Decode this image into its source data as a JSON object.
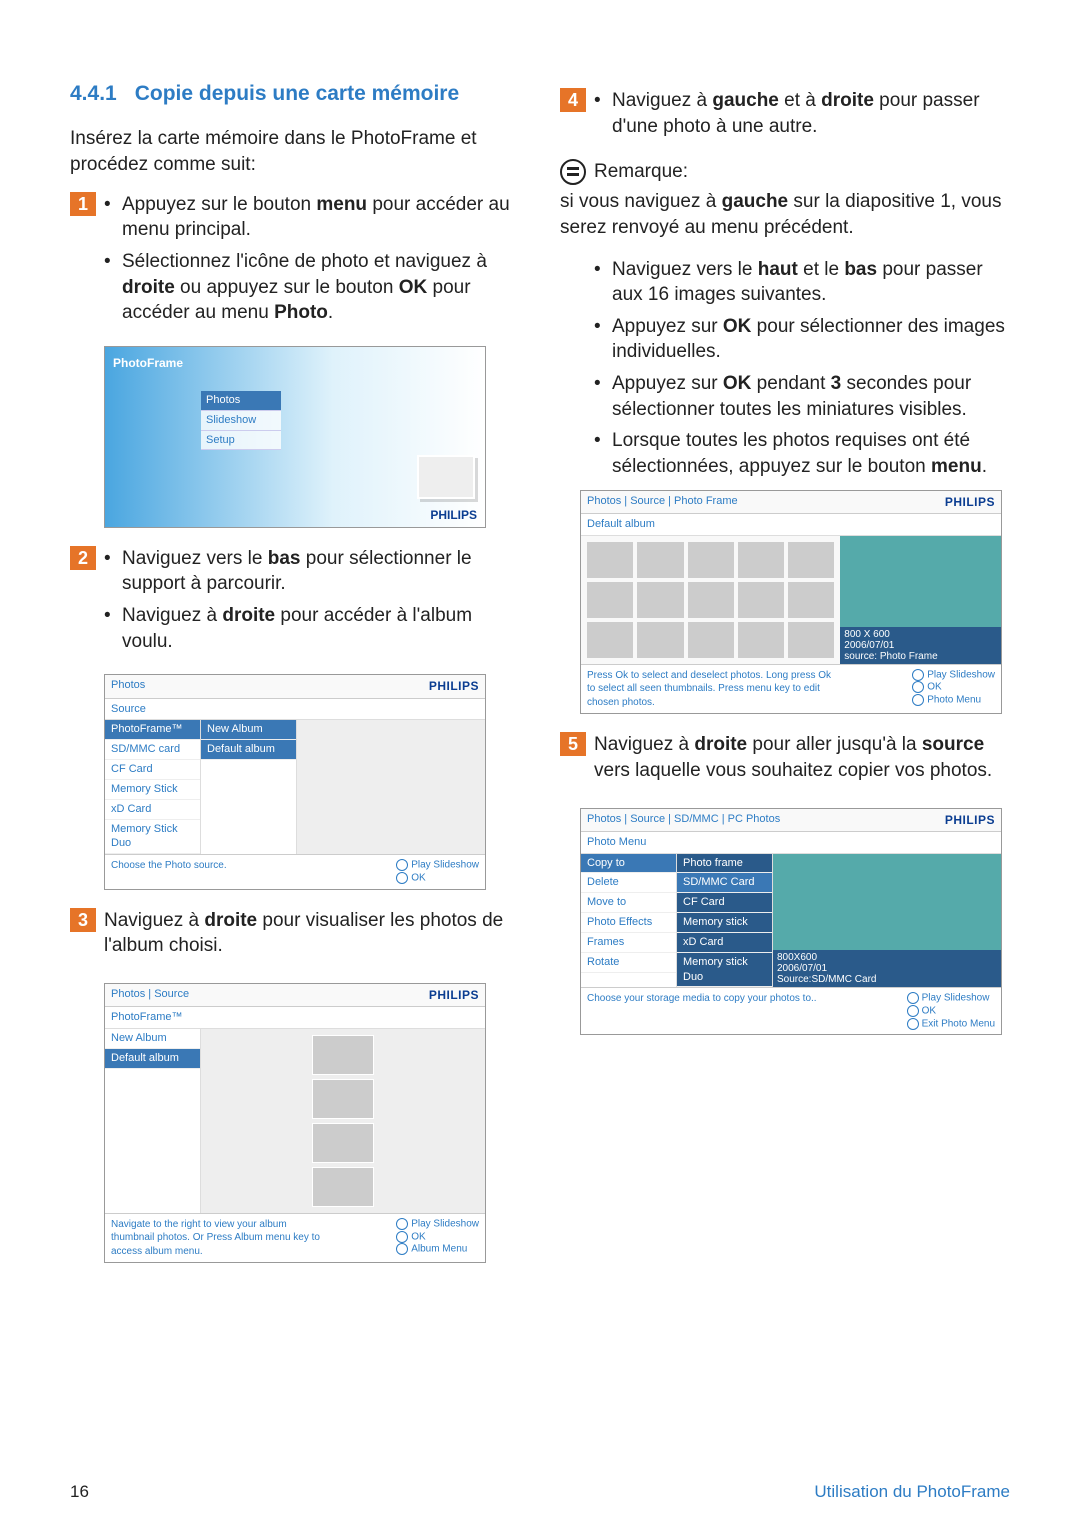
{
  "section": {
    "number": "4.4.1",
    "title": "Copie depuis une carte mémoire"
  },
  "intro": "Insérez la carte mémoire dans le PhotoFrame et procédez comme suit:",
  "step1": {
    "b1a": "Appuyez sur le bouton ",
    "b1b": "menu",
    "b1c": " pour accéder au menu principal.",
    "b2a": "Sélectionnez l'icône de photo et naviguez à ",
    "b2b": "droite",
    "b2c": " ou appuyez sur le bouton ",
    "b2d": "OK",
    "b2e": " pour accéder au menu ",
    "b2f": "Photo",
    "b2g": "."
  },
  "ss_main": {
    "title": "PhotoFrame",
    "items": [
      "Photos",
      "Slideshow",
      "Setup"
    ],
    "brand": "PHILIPS"
  },
  "step2": {
    "b1a": "Naviguez vers le ",
    "b1b": "bas",
    "b1c": " pour sélectionner le support à parcourir.",
    "b2a": "Naviguez à ",
    "b2b": "droite",
    "b2c": " pour accéder à l'album voulu."
  },
  "ss_source": {
    "crumb": "Photos",
    "sub": "Source",
    "left": [
      "PhotoFrame™",
      "SD/MMC card",
      "CF Card",
      "Memory Stick",
      "xD Card",
      "Memory Stick Duo"
    ],
    "right": [
      "New Album",
      "Default album"
    ],
    "help": "Choose the Photo source.",
    "foot": [
      "Play Slideshow",
      "OK"
    ],
    "brand": "PHILIPS"
  },
  "step3": {
    "a": "Naviguez à ",
    "b": "droite",
    "c": " pour visualiser les photos de l'album choisi."
  },
  "ss_album": {
    "crumb": "Photos | Source",
    "sub": "PhotoFrame™",
    "left": [
      "New Album",
      "Default album"
    ],
    "help": "Navigate to the right to view your album thumbnail photos. Or Press Album menu key to access album menu.",
    "foot": [
      "Play Slideshow",
      "OK",
      "Album Menu"
    ],
    "brand": "PHILIPS"
  },
  "step4": {
    "b1a": "Naviguez à ",
    "b1b": "gauche",
    "b1c": " et à ",
    "b1d": "droite",
    "b1e": " pour passer d'une photo à une autre."
  },
  "note_label": "Remarque:",
  "note_body": {
    "a": "si vous naviguez à ",
    "b": "gauche",
    "c": " sur la diapositive 1, vous serez renvoyé au menu précédent."
  },
  "more": {
    "m1a": "Naviguez vers le ",
    "m1b": "haut",
    "m1c": " et le ",
    "m1d": "bas",
    "m1e": " pour passer aux 16 images suivantes.",
    "m2a": "Appuyez sur ",
    "m2b": "OK",
    "m2c": " pour sélectionner des images individuelles.",
    "m3a": "Appuyez sur ",
    "m3b": "OK",
    "m3c": " pendant ",
    "m3d": "3",
    "m3e": " secondes pour sélectionner toutes les miniatures visibles.",
    "m4a": "Lorsque toutes les photos requises ont été sélectionnées, appuyez sur le bouton ",
    "m4b": "menu",
    "m4c": "."
  },
  "ss_thumbs": {
    "crumb": "Photos | Source | Photo Frame",
    "sub": "Default album",
    "meta": [
      "800 X 600",
      "2006/07/01",
      "source: Photo Frame"
    ],
    "help": "Press Ok to select and deselect photos. Long press Ok to select all seen thumbnails. Press menu key to edit chosen photos.",
    "foot": [
      "Play Slideshow",
      "OK",
      "Photo Menu"
    ],
    "brand": "PHILIPS"
  },
  "step5": {
    "a": "Naviguez à ",
    "b": "droite",
    "c": " pour aller jusqu'à la ",
    "d": "source",
    "e": " vers laquelle vous souhaitez copier vos photos."
  },
  "ss_copy": {
    "crumb": "Photos | Source | SD/MMC | PC Photos",
    "sub": "Photo Menu",
    "left": [
      "Copy to",
      "Delete",
      "Move to",
      "Photo Effects",
      "Frames",
      "Rotate"
    ],
    "right": [
      "Photo frame",
      "SD/MMC Card",
      "CF Card",
      "Memory stick",
      "xD Card",
      "Memory stick Duo"
    ],
    "meta": [
      "800X600",
      "2006/07/01",
      "Source:SD/MMC Card"
    ],
    "help": "Choose your storage media to copy your photos to..",
    "foot": [
      "Play Slideshow",
      "OK",
      "Exit Photo Menu"
    ],
    "brand": "PHILIPS"
  },
  "footer": {
    "page": "16",
    "label": "Utilisation du PhotoFrame"
  }
}
